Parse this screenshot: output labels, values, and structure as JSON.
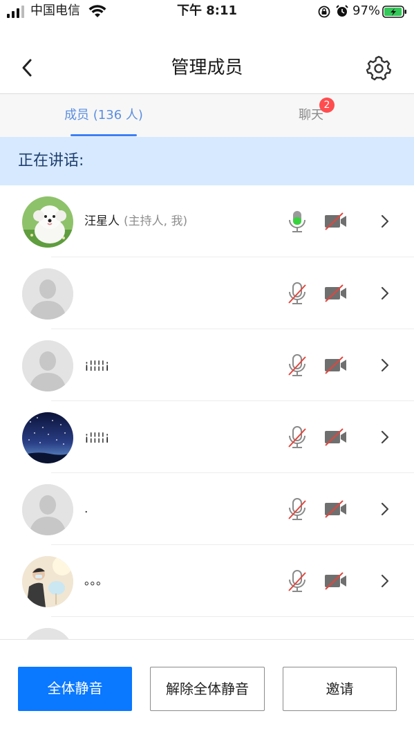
{
  "status_bar": {
    "carrier": "中国电信",
    "time": "下午 8:11",
    "battery_percent": "97%",
    "battery_level": 0.97
  },
  "nav": {
    "title": "管理成员",
    "back_icon": "chevron-left-icon",
    "settings_icon": "gear-icon"
  },
  "tabs": {
    "members_label": "成员 (136 人)",
    "chat_label": "聊天",
    "chat_badge": "2"
  },
  "speaking": {
    "label": "正在讲话:"
  },
  "members": [
    {
      "name": "汪星人",
      "tag": "(主持人, 我)",
      "avatar": "dog-photo",
      "mic": "active",
      "camera": "off"
    },
    {
      "name": "",
      "tag": "",
      "avatar": "default-person",
      "mic": "muted",
      "camera": "off"
    },
    {
      "name": "¡¦¦¦¦¡",
      "tag": "",
      "avatar": "default-person",
      "mic": "muted",
      "camera": "off"
    },
    {
      "name": "¡¦¦¦¦¡",
      "tag": "",
      "avatar": "night-sky-photo",
      "mic": "muted",
      "camera": "off"
    },
    {
      "name": ".",
      "tag": "",
      "avatar": "default-person",
      "mic": "muted",
      "camera": "off"
    },
    {
      "name": "。。。",
      "tag": "",
      "avatar": "person-photo",
      "mic": "muted",
      "camera": "off"
    }
  ],
  "actions": {
    "mute_all": "全体静音",
    "unmute_all": "解除全体静音",
    "invite": "邀请"
  },
  "colors": {
    "primary_blue": "#0a78ff",
    "tab_active": "#5a8ee0",
    "banner_bg": "#d6e9ff",
    "badge_red": "#ff4d4f",
    "mic_active_green": "#39d23f",
    "muted_slash": "#e2453c"
  }
}
